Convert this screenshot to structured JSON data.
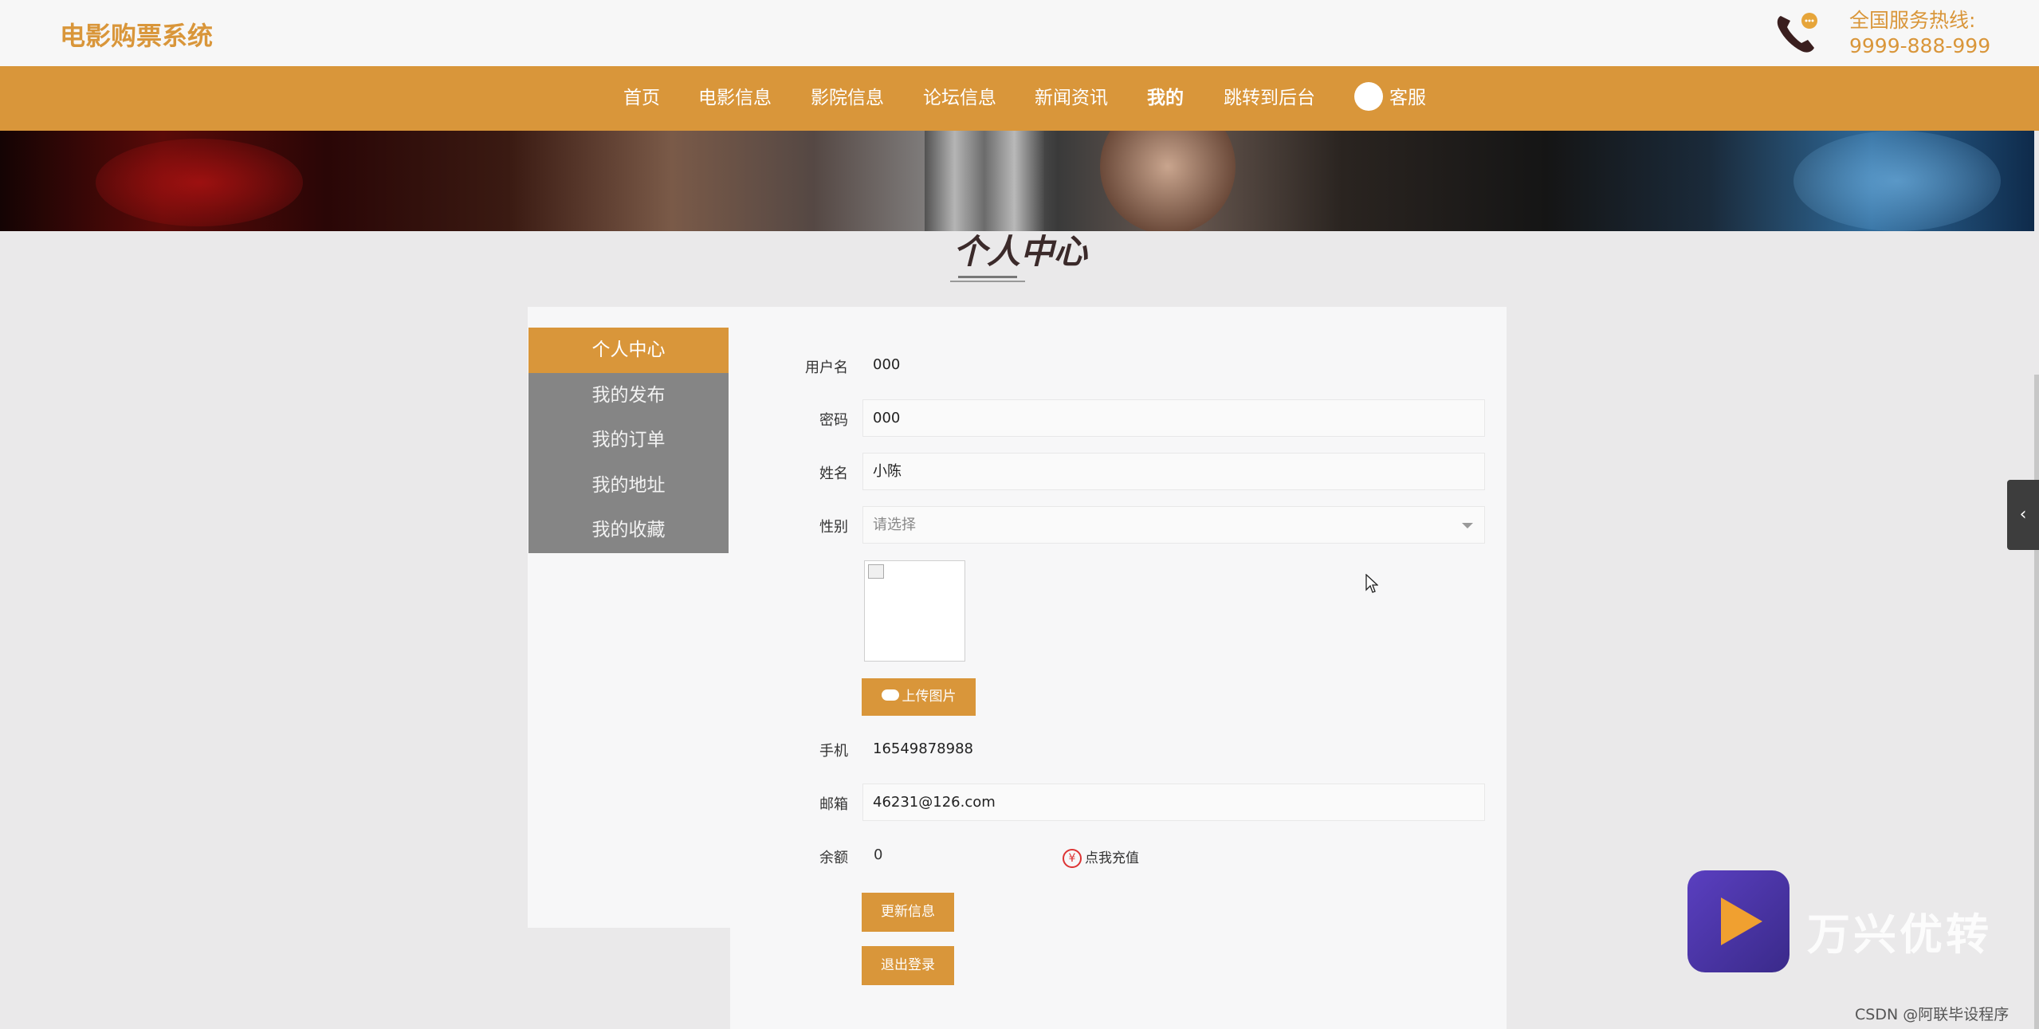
{
  "header": {
    "site_title": "电影购票系统",
    "hotline_label": "全国服务热线:",
    "hotline_number": "9999-888-999"
  },
  "nav": {
    "items": [
      {
        "label": "首页"
      },
      {
        "label": "电影信息"
      },
      {
        "label": "影院信息"
      },
      {
        "label": "论坛信息"
      },
      {
        "label": "新闻资讯"
      },
      {
        "label": "我的"
      },
      {
        "label": "跳转到后台"
      },
      {
        "label": "客服"
      }
    ],
    "active": "我的"
  },
  "page": {
    "section_title": "个人中心"
  },
  "sidebar": {
    "items": [
      {
        "label": "个人中心"
      },
      {
        "label": "我的发布"
      },
      {
        "label": "我的订单"
      },
      {
        "label": "我的地址"
      },
      {
        "label": "我的收藏"
      }
    ],
    "active": "个人中心"
  },
  "form": {
    "username_label": "用户名",
    "username_value": "000",
    "password_label": "密码",
    "password_value": "000",
    "name_label": "姓名",
    "name_value": "小陈",
    "gender_label": "性别",
    "gender_placeholder": "请选择",
    "upload_label": "上传图片",
    "phone_label": "手机",
    "phone_value": "16549878988",
    "email_label": "邮箱",
    "email_value": "46231@126.com",
    "balance_label": "余额",
    "balance_value": "0",
    "recharge_label": "点我充值",
    "update_label": "更新信息",
    "logout_label": "退出登录"
  },
  "watermark": {
    "brand": "万兴优转",
    "credit": "CSDN @阿联毕设程序"
  },
  "colors": {
    "accent": "#d9963a",
    "sidebar_bg": "#858585",
    "page_bg": "#eae9ea"
  }
}
